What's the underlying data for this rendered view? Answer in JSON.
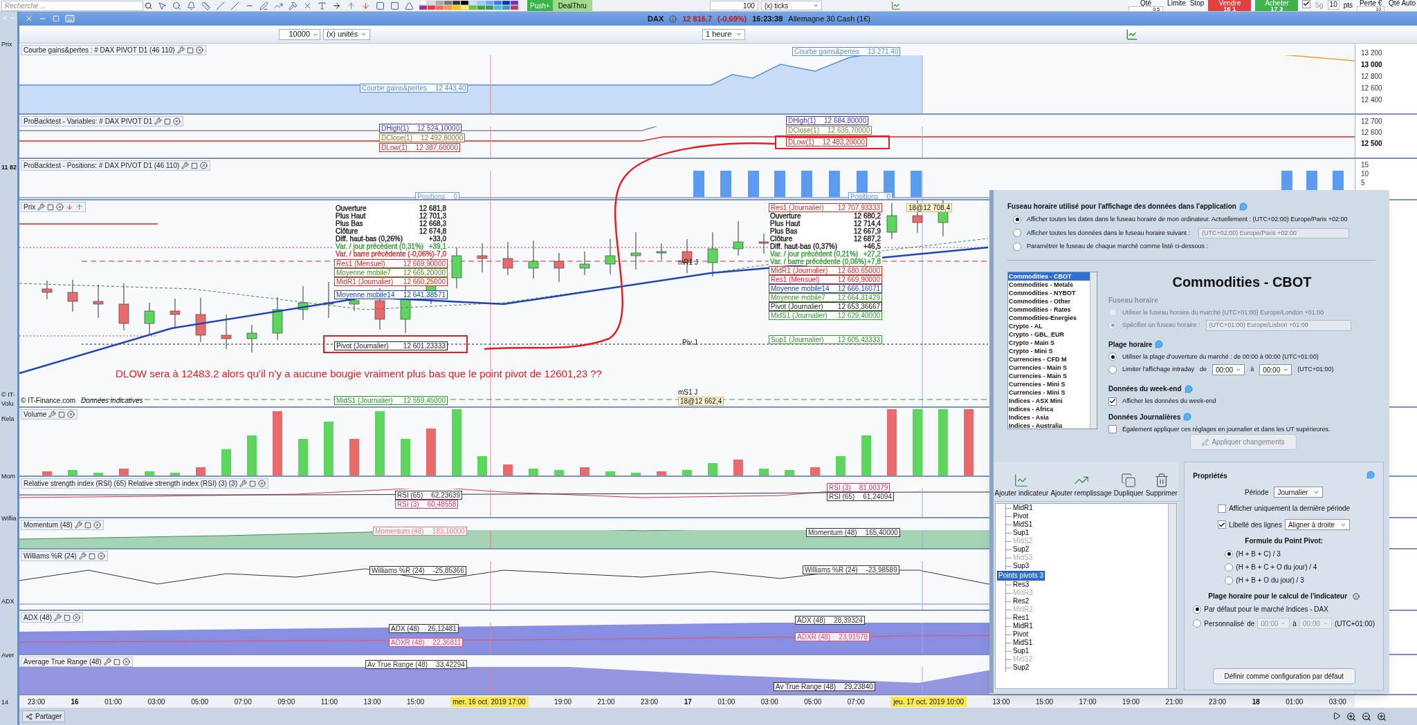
{
  "toolbar": {
    "search": {
      "placeholder": "Recherche ..."
    },
    "push": "Push+",
    "dealthru": "DealThru",
    "ticks": {
      "value": "100",
      "unit": "(x) ticks"
    },
    "order": {
      "qty_label": "Qté",
      "qty": "0,5",
      "limit": "Limite",
      "stop": "Stop",
      "sell": {
        "label": "Vendre",
        "price": "16",
        "fraction": "1"
      },
      "buy": {
        "label": "Acheter",
        "price": "17",
        "fraction": "3"
      },
      "sg": {
        "label": "Sg",
        "checked": true
      },
      "points": "10",
      "points_unit": "pts",
      "loss_label": "Perte €",
      "loss": "10",
      "auto_label": "Qté Auto"
    }
  },
  "window": {
    "instrument": "DAX",
    "price": "12 816,7",
    "change": "(-0,69%)",
    "time": "16:23:38",
    "name": "Allemagne 30 Cash (1€)"
  },
  "chart_toolbar": {
    "units": {
      "value": "10000",
      "unit": "(x) unités"
    },
    "period": "1 heure"
  },
  "left_strip": [
    "Prix",
    "11 82",
    "© IT-",
    "Volu",
    "Rela",
    "Mom",
    "Willia",
    "ADX",
    "Aver",
    "14"
  ],
  "panels": [
    {
      "kind": "equity",
      "title": "Courbe gains&pertes : # DAX PIVOT D1 (46 110)",
      "labels": [
        {
          "name": "Courbe gains&pertes",
          "value": "12 443,40",
          "color": "#5b8fd6"
        },
        {
          "name": "Courbe gains&pertes",
          "value": "13 271,40",
          "color": "#5b8fd6"
        }
      ],
      "axis": [
        {
          "label": "13 200",
          "current": false
        },
        {
          "label": "13 000",
          "current": true
        },
        {
          "label": "12 800",
          "current": false
        },
        {
          "label": "12 600",
          "current": false
        },
        {
          "label": "12 400",
          "current": false
        }
      ]
    },
    {
      "kind": "variables",
      "title": "ProBacktest - Variables: # DAX PIVOT D1",
      "labels": [
        {
          "name": "DHigh(1)",
          "value": "12 524,10000",
          "color": "#3a3ab8"
        },
        {
          "name": "DClose(1)",
          "value": "12 492,80000",
          "color": "#8a7a3a"
        },
        {
          "name": "DLow(1)",
          "value": "12 387,60000",
          "color": "#d42a2a"
        },
        {
          "name": "DHigh(1)",
          "value": "12 684,80000",
          "color": "#3a3ab8"
        },
        {
          "name": "DClose(1)",
          "value": "12 635,70000",
          "color": "#8a7a3a"
        },
        {
          "name": "DLow(1)",
          "value": "12 483,20000",
          "color": "#d42a2a"
        }
      ],
      "axis": [
        {
          "label": "12 700",
          "current": false
        },
        {
          "label": "12 600",
          "current": false
        },
        {
          "label": "12 500",
          "current": true
        }
      ]
    },
    {
      "kind": "positions",
      "title": "ProBacktest - Positions: # DAX PIVOT D1 (46 110)",
      "labels": [
        {
          "name": "Positions",
          "value": "0",
          "color": "#6f9fe0"
        },
        {
          "name": "Positions",
          "value": "0",
          "color": "#6f9fe0"
        }
      ],
      "axis": [
        {
          "label": "15",
          "current": false
        },
        {
          "label": "10",
          "current": false
        },
        {
          "label": "5",
          "current": false
        }
      ]
    },
    {
      "kind": "price",
      "title": "Prix",
      "left_info": [
        {
          "label": "Ouverture",
          "value": "12 681,8",
          "color": "#111111"
        },
        {
          "label": "Plus Haut",
          "value": "12 701,3",
          "color": "#111111"
        },
        {
          "label": "Plus Bas",
          "value": "12 668,3",
          "color": "#111111"
        },
        {
          "label": "Clôture",
          "value": "12 674,8",
          "color": "#111111"
        },
        {
          "label": "Diff. haut-bas (0,26%)",
          "value": "+33,0",
          "color": "#111111"
        },
        {
          "label": "Var. / jour précédent (0,31%)",
          "value": "+39,1",
          "color": "#2e9a2e"
        },
        {
          "label": "Var. / barre précédente (-0,06%)",
          "value": "-7,0",
          "color": "#d42a2a"
        }
      ],
      "right_info": [
        {
          "label": "Ouverture",
          "value": "12 680,2",
          "color": "#111111"
        },
        {
          "label": "Plus Haut",
          "value": "12 714,4",
          "color": "#111111"
        },
        {
          "label": "Plus Bas",
          "value": "12 667,9",
          "color": "#111111"
        },
        {
          "label": "Clôture",
          "value": "12 687,2",
          "color": "#111111"
        },
        {
          "label": "Diff. haut-bas (0,37%)",
          "value": "+46,5",
          "color": "#111111"
        },
        {
          "label": "Var. / jour précédent (0,21%)",
          "value": "+27,2",
          "color": "#2e9a2e"
        },
        {
          "label": "Var. / barre précédente (0,06%)",
          "value": "+7,8",
          "color": "#2e9a2e"
        }
      ],
      "labels": [
        {
          "name": "Res1 (Mensuel)",
          "value": "12 669,90000",
          "color": "#d42a2a"
        },
        {
          "name": "Moyenne mobile7",
          "value": "12 665,20000",
          "color": "#4a8a2a"
        },
        {
          "name": "MidR1 (Journalier)",
          "value": "12 660,25000",
          "color": "#d42a2a"
        },
        {
          "name": "Moyenne mobile14",
          "value": "12 641,38571",
          "color": "#1f45b0"
        },
        {
          "name": "Pivot (Journalier)",
          "value": "12 601,23333",
          "color": "#222222"
        },
        {
          "name": "MidS1 (Journalier)",
          "value": "12 559,45000",
          "color": "#2e9a2e"
        },
        {
          "name": "Res1 (Journalier)",
          "value": "12 707,93333",
          "color": "#d42a2a"
        },
        {
          "name": "MidR1 (Journalier)",
          "value": "12 680,65000",
          "color": "#d42a2a"
        },
        {
          "name": "Res1 (Mensuel)",
          "value": "12 669,90000",
          "color": "#d42a2a"
        },
        {
          "name": "Moyenne mobile14",
          "value": "12 666,16071",
          "color": "#1f45b0"
        },
        {
          "name": "Moyenne mobile7",
          "value": "12 664,31429",
          "color": "#4a8a2a"
        },
        {
          "name": "Pivot (Journalier)",
          "value": "12 653,36667",
          "color": "#222222"
        },
        {
          "name": "MidS1 (Journalier)",
          "value": "12 629,40000",
          "color": "#2e9a2e"
        },
        {
          "name": "Sup1 (Journalier)",
          "value": "12 605,43333",
          "color": "#2e9a2e"
        }
      ],
      "markers": [
        "mR1 J",
        "Piv J",
        "mS1 J",
        "18@12 662,4",
        "18@12 708,4"
      ],
      "annotation": "DLOW sera à 12483.2 alors qu’il n’y a aucune bougie vraiment plus bas que le point pivot de 12601,23 ??",
      "footer": "© IT-Finance.com",
      "footer_note": "Données indicatives"
    },
    {
      "kind": "volume",
      "title": "Volume"
    },
    {
      "kind": "rsi",
      "title": "Relative strength index (RSI) (65) Relative strength index (RSI) (3) (3)",
      "labels": [
        {
          "name": "RSI (65)",
          "value": "62,23639",
          "color": "#333333"
        },
        {
          "name": "RSI (3)",
          "value": "60,48558",
          "color": "#d4306a"
        },
        {
          "name": "RSI (3)",
          "value": "81,00379",
          "color": "#d4306a"
        },
        {
          "name": "RSI (65)",
          "value": "61,24094",
          "color": "#333333"
        }
      ]
    },
    {
      "kind": "momentum",
      "title": "Momentum (48)",
      "labels": [
        {
          "name": "Momentum (48)",
          "value": "183,10000",
          "color": "#e07a8a"
        },
        {
          "name": "Momentum (48)",
          "value": "165,40000",
          "color": "#333333"
        }
      ]
    },
    {
      "kind": "williams",
      "title": "Williams %R (24)",
      "labels": [
        {
          "name": "Williams %R (24)",
          "value": "-25,85366",
          "color": "#333333"
        },
        {
          "name": "Williams %R (24)",
          "value": "-23,98589",
          "color": "#333333"
        }
      ]
    },
    {
      "kind": "adx",
      "title": "ADX (48)",
      "labels": [
        {
          "name": "ADX (48)",
          "value": "26,12481",
          "color": "#333333"
        },
        {
          "name": "ADXR (48)",
          "value": "22,36811",
          "color": "#e05070"
        },
        {
          "name": "ADX (48)",
          "value": "28,39324",
          "color": "#333333"
        },
        {
          "name": "ADXR (48)",
          "value": "23,91578",
          "color": "#e05070"
        }
      ]
    },
    {
      "kind": "atr",
      "title": "Average True Range (48)",
      "labels": [
        {
          "name": "Av True Range (48)",
          "value": "33,42294",
          "color": "#333333"
        },
        {
          "name": "Av True Range (48)",
          "value": "29,23840",
          "color": "#333333"
        }
      ]
    }
  ],
  "time_axis": [
    {
      "label": "23:00",
      "highlighted": false
    },
    {
      "label": "16",
      "highlighted": false
    },
    {
      "label": "01:00",
      "highlighted": false
    },
    {
      "label": "03:00",
      "highlighted": false
    },
    {
      "label": "05:00",
      "highlighted": false
    },
    {
      "label": "07:00",
      "highlighted": false
    },
    {
      "label": "09:00",
      "highlighted": false
    },
    {
      "label": "11:00",
      "highlighted": false
    },
    {
      "label": "13:00",
      "highlighted": false
    },
    {
      "label": "15:00",
      "highlighted": false
    },
    {
      "label": "mer. 16 oct. 2019 17:00",
      "highlighted": true
    },
    {
      "label": "19:00",
      "highlighted": false
    },
    {
      "label": "21:00",
      "highlighted": false
    },
    {
      "label": "23:00",
      "highlighted": false
    },
    {
      "label": "17",
      "highlighted": false
    },
    {
      "label": "01:00",
      "highlighted": false
    },
    {
      "label": "03:00",
      "highlighted": false
    },
    {
      "label": "05:00",
      "highlighted": false
    },
    {
      "label": "07:00",
      "highlighted": false
    },
    {
      "label": "jeu. 17 oct. 2019 10:00",
      "highlighted": true
    },
    {
      "label": "13:00",
      "highlighted": false
    },
    {
      "label": "15:00",
      "highlighted": false
    },
    {
      "label": "17:00",
      "highlighted": false
    },
    {
      "label": "19:00",
      "highlighted": false
    },
    {
      "label": "21:00",
      "highlighted": false
    },
    {
      "label": "23:00",
      "highlighted": false
    },
    {
      "label": "18",
      "highlighted": false
    },
    {
      "label": "01:00",
      "highlighted": false
    },
    {
      "label": "03:00",
      "highlighted": false
    }
  ],
  "timezone_dialog": {
    "heading": "Fuseau horaire utilisé pour l'affichage des données dans l'application",
    "options": [
      {
        "label": "Afficher toutes les dates dans le fuseau horaire de mon ordinateur. Actuellement : (UTC+02:00) Europe/Paris +02:00",
        "selected": true
      },
      {
        "label": "Afficher toutes les données dans le fuseau horaire suivant :",
        "selected": false,
        "select_value": "(UTC+02:00) Europe/Paris +02:00"
      },
      {
        "label": "Paramétrer le fuseau de chaque marché comme listé ci-dessous :",
        "selected": false
      }
    ],
    "markets": [
      {
        "label": "Commodities - CBOT",
        "selected": true
      },
      {
        "label": "Commodities - Metals",
        "selected": false
      },
      {
        "label": "Commodities - NYBOT",
        "selected": false
      },
      {
        "label": "Commodities - Other",
        "selected": false
      },
      {
        "label": "Commodities - Rates",
        "selected": false
      },
      {
        "label": "Commodities-Energies",
        "selected": false
      },
      {
        "label": "Crypto - AL",
        "selected": false
      },
      {
        "label": "Crypto - GBL_EUR",
        "selected": false
      },
      {
        "label": "Crypto - Main S",
        "selected": false
      },
      {
        "label": "Crypto - Mini S",
        "selected": false
      },
      {
        "label": "Currencies - CFD M",
        "selected": false
      },
      {
        "label": "Currencies - Main S",
        "selected": false
      },
      {
        "label": "Currencies - Main S",
        "selected": false
      },
      {
        "label": "Currencies - Mini S",
        "selected": false
      },
      {
        "label": "Currencies - Mini S",
        "selected": false
      },
      {
        "label": "Indices - ASX Mini",
        "selected": false
      },
      {
        "label": "Indices - Africa",
        "selected": false
      },
      {
        "label": "Indices - Asia",
        "selected": false
      },
      {
        "label": "Indices - Australia",
        "selected": false
      }
    ],
    "market_title": "Commodities - CBOT",
    "zone_heading": "Fuseau horaire",
    "zone_disabled": true,
    "zone_options": [
      {
        "label": "Utiliser le fuseau horaire du marché (UTC+01:00) Europe/London +01:00",
        "selected": false
      },
      {
        "label": "Spécifier un fuseau horaire :",
        "selected": true,
        "select_value": "(UTC+01:00) Europe/Lisbon +01:00"
      }
    ],
    "range_heading": "Plage horaire",
    "range_options": [
      {
        "label": "Utiliser la plage d'ouverture du marché : de 00:00 à 00:00  (UTC+01:00)",
        "selected": true
      },
      {
        "label": "Limiter l'affichage intraday",
        "selected": false
      }
    ],
    "from_label": "de",
    "from": "00:00",
    "to_label": "à",
    "to": "00:00",
    "tz": "(UTC+01:00)",
    "weekend_heading": "Données du week-end",
    "weekend": {
      "label": "Afficher les données du week-end",
      "checked": true
    },
    "daily_heading": "Données Journalières",
    "daily": {
      "label": "Également appliquer ces réglages en journalier et dans les UT supérieures.",
      "checked": false
    },
    "apply": "Appliquer changements"
  },
  "indicator_editor": {
    "tools": [
      "Ajouter indicateur",
      "Ajouter remplissage",
      "Dupliquer",
      "Supprimer"
    ],
    "tree": [
      {
        "selected": false,
        "children": [
          {
            "label": "MidR1",
            "disabled": false
          },
          {
            "label": "Pivot",
            "disabled": false
          },
          {
            "label": "MidS1",
            "disabled": false
          },
          {
            "label": "Sup1",
            "disabled": false
          },
          {
            "label": "MidS2",
            "disabled": true
          },
          {
            "label": "Sup2",
            "disabled": false
          },
          {
            "label": "MidS3",
            "disabled": true
          },
          {
            "label": "Sup3",
            "disabled": false
          }
        ]
      },
      {
        "label": "Points pivots 3",
        "selected": true,
        "children": [
          {
            "label": "Res3",
            "disabled": false
          },
          {
            "label": "MidR3",
            "disabled": true
          },
          {
            "label": "Res2",
            "disabled": false
          },
          {
            "label": "MidR2",
            "disabled": true
          },
          {
            "label": "Res1",
            "disabled": false
          },
          {
            "label": "MidR1",
            "disabled": false
          },
          {
            "label": "Pivot",
            "disabled": false
          },
          {
            "label": "MidS1",
            "disabled": false
          },
          {
            "label": "Sup1",
            "disabled": false
          },
          {
            "label": "MidS2",
            "disabled": true
          },
          {
            "label": "Sup2",
            "disabled": false
          }
        ]
      }
    ]
  },
  "properties": {
    "title": "Propriétés",
    "period_label": "Période",
    "period": "Journalier",
    "last_only": {
      "label": "Afficher uniquement la dernière période",
      "checked": false
    },
    "line_labels": {
      "label": "Libellé des lignes",
      "checked": true,
      "value": "Aligner à droite"
    },
    "formula_heading": "Formule du Point Pivot:",
    "formulas": [
      {
        "label": "(H + B + C) / 3",
        "selected": true
      },
      {
        "label": "(H + B + C + O du jour) / 4",
        "selected": false
      },
      {
        "label": "(H + B + O du jour) / 3",
        "selected": false
      }
    ],
    "range_heading": "Plage horaire pour le calcul de l'indicateur",
    "range_options": [
      {
        "label": "Par défaut pour le marché Indices - DAX",
        "selected": true
      },
      {
        "label": "Personnalisé",
        "selected": false
      }
    ],
    "from_label": "de",
    "from": "00:00",
    "to_label": "à",
    "to": "00:00",
    "tz": "(UTC+01:00)",
    "default_button": "Définir comme configuration par défaut"
  },
  "bottom_bar": {
    "share": "Partager"
  }
}
